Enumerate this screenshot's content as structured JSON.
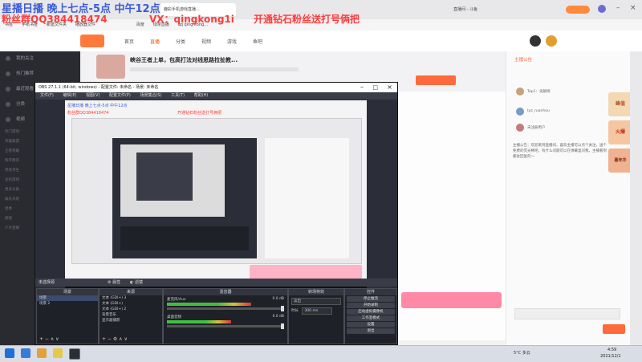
{
  "overlay": {
    "line1": "星播日播 晚上七点-5点 中午12点",
    "line2a": "粉丝群QQ384418474",
    "line2b": "VX：qingkong1i",
    "line2c": "开通钻石粉丝送打号俩把",
    "colors": {
      "line1": "#3b5bd9",
      "line2": "#ff3b3b"
    }
  },
  "browser": {
    "tabs": [
      "鹿彩手机游戏直播...",
      "直播间 - 斗鱼",
      "最新荒野乱斗..."
    ],
    "url": "https://www.douyu.com/...",
    "bookmarks": [
      "书签",
      "手机书签",
      "新建文件夹",
      "播放器文件",
      "百度",
      "绿茶直播",
      "qq qing kong..."
    ]
  },
  "site": {
    "nav": [
      "首页",
      "直播",
      "分类",
      "视频",
      "游戏",
      "鱼吧"
    ],
    "stream_title": "峡谷王者上单，包高打法对线思路拉扯教..."
  },
  "sidebar": {
    "items": [
      "我的关注",
      "热门推荐",
      "最近观看",
      "分类",
      "视频"
    ],
    "links": [
      "热门游戏",
      "英雄联盟",
      "王者荣耀",
      "和平精英",
      "绝地求生",
      "主机游戏",
      "更多分类",
      "娱乐天地",
      "星秀",
      "颜值",
      "户外直播"
    ]
  },
  "obs": {
    "title": "OBS 27.1.1 (64-bit, windows) - 配置文件: 未命名 - 场景: 未命名",
    "menu": [
      "文件(F)",
      "编辑(E)",
      "视图(V)",
      "配置文件(P)",
      "场景集合(S)",
      "工具(T)",
      "帮助(H)"
    ],
    "dock_label": "未选择源",
    "dock_buttons": [
      "属性",
      "滤镜"
    ],
    "scenes_header": "场景",
    "scenes": [
      "场景",
      "场景 2"
    ],
    "sources_header": "来源",
    "sources": [
      "文本 (GDI+) 3",
      "文本 (GDI+)",
      "文本 (GDI+) 2",
      "背景音乐",
      "显示器捕获"
    ],
    "mixer_header": "混音器",
    "mixer": [
      {
        "name": "麦克风/Aux",
        "db": "0.0 dB",
        "level": 0.72
      },
      {
        "name": "桌面音频",
        "db": "0.0 dB",
        "level": 0.55
      }
    ],
    "transitions_header": "转场特效",
    "transition_value": "淡出",
    "duration_label": "时长",
    "duration_value": "300 ms",
    "controls_header": "控件",
    "controls": [
      "停止推流",
      "开始录制",
      "启动虚拟摄像机",
      "工作室模式",
      "设置",
      "退出"
    ]
  },
  "chat": {
    "tab": "主播公告",
    "messages": [
      "Top1：贡献榜",
      "tyz_ruanhou",
      "未注册用户",
      "平安夜快乐"
    ],
    "notice": "主播公告：欢迎来到直播间，喜欢主播可以点个关注，送个免费的荧光棒吧，有什么问题可以在弹幕里问我，主播看到都会回复的～"
  },
  "promo": {
    "text1": "峰值",
    "text2": "嘉年华",
    "text3": "火爆"
  },
  "taskbar": {
    "weather": "5°C 多云",
    "time": "4:59",
    "date": "2021/12/1"
  }
}
